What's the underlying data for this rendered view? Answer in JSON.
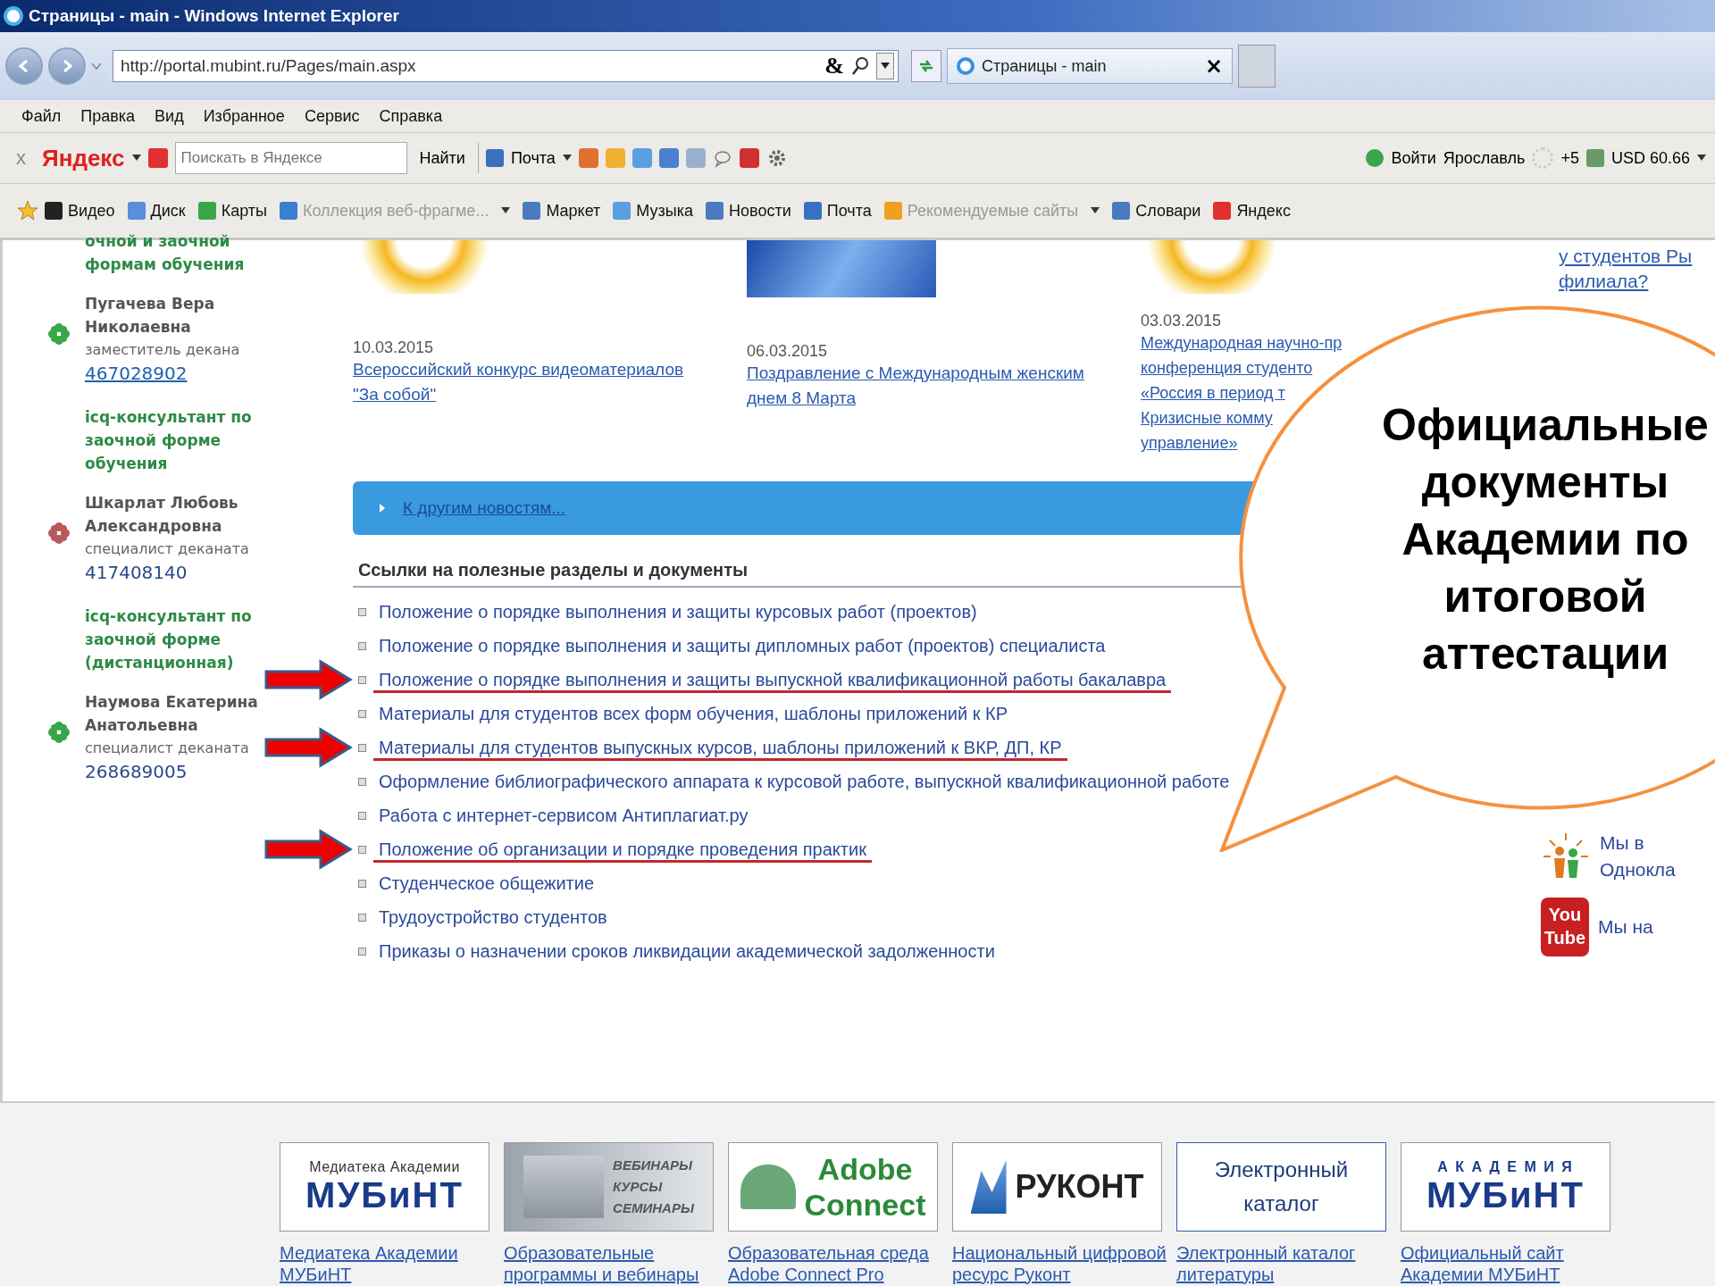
{
  "window": {
    "title": "Страницы - main - Windows Internet Explorer"
  },
  "address_bar": {
    "url": "http://portal.mubint.ru/Pages/main.aspx",
    "symbol": "&"
  },
  "tab": {
    "label": "Страницы - main",
    "close": "×"
  },
  "menu": [
    "Файл",
    "Правка",
    "Вид",
    "Избранное",
    "Сервис",
    "Справка"
  ],
  "yandex_bar": {
    "close": "x",
    "logo": "Яндекс",
    "search_placeholder": "Поискать в Яндексе",
    "search_button": "Найти",
    "mail": "Почта",
    "login": "Войти",
    "city": "Ярославль",
    "weather": "+5",
    "currency": "USD 60.66"
  },
  "favorites": [
    {
      "label": "Видео",
      "dimmed": false,
      "dropdown": false
    },
    {
      "label": "Диск",
      "dimmed": false,
      "dropdown": false
    },
    {
      "label": "Карты",
      "dimmed": false,
      "dropdown": false
    },
    {
      "label": "Коллекция веб-фрагме...",
      "dimmed": true,
      "dropdown": true
    },
    {
      "label": "Маркет",
      "dimmed": false,
      "dropdown": false
    },
    {
      "label": "Музыка",
      "dimmed": false,
      "dropdown": false
    },
    {
      "label": "Новости",
      "dimmed": false,
      "dropdown": false
    },
    {
      "label": "Почта",
      "dimmed": false,
      "dropdown": false
    },
    {
      "label": "Рекомендуемые сайты",
      "dimmed": true,
      "dropdown": true
    },
    {
      "label": "Словари",
      "dimmed": false,
      "dropdown": false
    },
    {
      "label": "Яндекс",
      "dimmed": false,
      "dropdown": false
    }
  ],
  "sidebar": [
    {
      "kind": "heading",
      "text": "очной и заочной формам обучения"
    },
    {
      "kind": "contact",
      "name": "Пугачева Вера Николаевна",
      "role": "заместитель декана",
      "icq": "467028902",
      "linked": true,
      "color": "#3aa64a"
    },
    {
      "kind": "heading",
      "text": "icq-консультант по заочной форме обучения"
    },
    {
      "kind": "contact",
      "name": "Шкарлат Любовь Александровна",
      "role": "специалист деканата",
      "icq": "417408140",
      "linked": false,
      "color": "#b85a5a"
    },
    {
      "kind": "heading",
      "text": "icq-консультант по заочной форме (дистанционная)"
    },
    {
      "kind": "contact",
      "name": "Наумова Екатерина Анатольевна",
      "role": "специалист деканата",
      "icq": "268689005",
      "linked": false,
      "color": "#3aa64a"
    }
  ],
  "news": [
    {
      "date": "10.03.2015",
      "title_lines": [
        "Всероссийский конкурс видеоматериалов",
        "\"За собой\""
      ]
    },
    {
      "date": "06.03.2015",
      "title_lines": [
        "Поздравление с Международным женским",
        "днем 8 Марта"
      ]
    },
    {
      "date": "03.03.2015",
      "title_lines": [
        "Международная научно-пр",
        "конференция студенто",
        "«Россия в период т",
        "Кризисные комму",
        "управление»"
      ]
    }
  ],
  "more_news": "К другим новостям...",
  "links_section": {
    "title": "Ссылки на полезные разделы и документы",
    "items": [
      {
        "text": "Положение о порядке выполнения и защиты курсовых работ (проектов)",
        "highlighted": false
      },
      {
        "text": "Положение о порядке выполнения и защиты дипломных работ (проектов) специалиста",
        "highlighted": false
      },
      {
        "text": "Положение о порядке выполнения и защиты выпускной квалификационной работы бакалавра",
        "highlighted": true
      },
      {
        "text": "Материалы для студентов всех форм обучения, шаблоны приложений к КР",
        "highlighted": false
      },
      {
        "text": "Материалы для студентов выпускных курсов, шаблоны приложений к ВКР, ДП, КР",
        "highlighted": true
      },
      {
        "text": "Оформление библиографического аппарата к курсовой работе, выпускной квалификационной работе",
        "highlighted": false
      },
      {
        "text": "Работа с интернет-сервисом Антиплагиат.ру",
        "highlighted": false
      },
      {
        "text": "Положение об организации и порядке проведения практик",
        "highlighted": true
      },
      {
        "text": "Студенческое общежитие",
        "highlighted": false
      },
      {
        "text": "Трудоустройство студентов",
        "highlighted": false
      },
      {
        "text": "Приказы о назначении сроков ликвидации академической задолженности",
        "highlighted": false
      }
    ]
  },
  "right_column": {
    "top_link_lines": [
      "у студентов Ры",
      "филиала?"
    ],
    "social": [
      {
        "kind": "ok",
        "lines": [
          "Мы в",
          "Однокла"
        ]
      },
      {
        "kind": "youtube",
        "lines": [
          "Мы на"
        ],
        "logo_lines": [
          "You",
          "Tube"
        ]
      }
    ]
  },
  "callout": {
    "text": "Официальные документы Академии по итоговой аттестации"
  },
  "footer_banners": [
    {
      "kind": "media",
      "lines": [
        "Медиатека Академии",
        "МУБиНТ"
      ],
      "caption_lines": [
        "Медиатека Академии",
        "МУБиНТ"
      ]
    },
    {
      "kind": "webinar",
      "lines": [
        "ВЕБИНАРЫ",
        "КУРСЫ",
        "СЕМИНАРЫ"
      ],
      "caption_lines": [
        "Образовательные",
        "программы и вебинары"
      ]
    },
    {
      "kind": "adobe",
      "lines": [
        "Adobe",
        "Connect"
      ],
      "caption_lines": [
        "Образовательная среда",
        "Adobe Connect Pro"
      ]
    },
    {
      "kind": "rukont",
      "lines": [
        "РУКОНТ"
      ],
      "caption_lines": [
        "Национальный цифровой",
        "ресурс Руконт"
      ]
    },
    {
      "kind": "catalog",
      "lines": [
        "Электронный",
        "каталог"
      ],
      "caption_lines": [
        "Электронный каталог",
        "литературы"
      ]
    },
    {
      "kind": "academy",
      "lines": [
        "А К А Д Е М И Я",
        "МУБиНТ"
      ],
      "caption_lines": [
        "Официальный сайт",
        "Академии МУБиНТ"
      ]
    }
  ]
}
